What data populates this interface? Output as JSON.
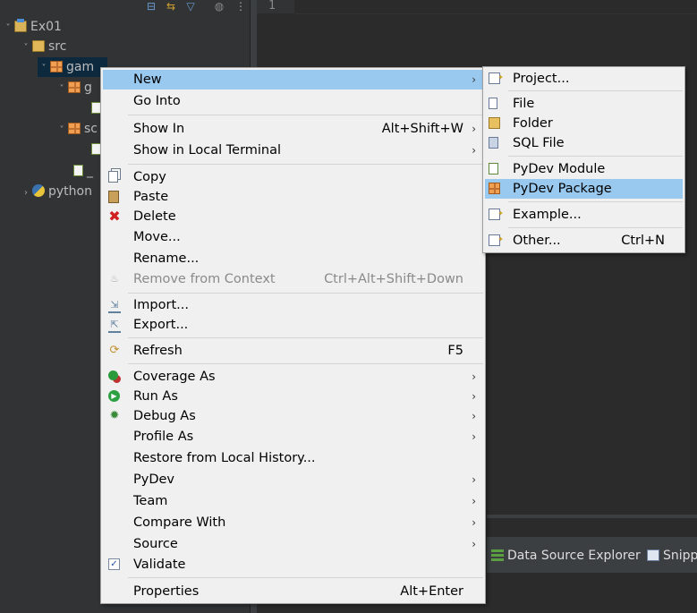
{
  "explorer": {
    "tree": [
      {
        "label": "Ex01",
        "icon": "project-icon",
        "arrow": "˅"
      },
      {
        "label": "src",
        "icon": "source-folder-icon",
        "arrow": "˅"
      },
      {
        "label": "gam",
        "icon": "package-icon",
        "arrow": "˅"
      },
      {
        "label": "g",
        "icon": "package-icon",
        "arrow": "˅"
      },
      {
        "label": "sc",
        "icon": "package-icon",
        "arrow": "˅"
      },
      {
        "label": "_",
        "icon": "pyfile-icon",
        "arrow": ""
      },
      {
        "label": "python",
        "icon": "python-icon",
        "arrow": "›"
      }
    ]
  },
  "editor": {
    "line_number": "1"
  },
  "bottom_tabs": [
    {
      "label": "Data Source Explorer",
      "icon": "data-source-icon"
    },
    {
      "label": "Snipp",
      "icon": "snippets-icon"
    }
  ],
  "context_menu": {
    "items": [
      {
        "label": "New",
        "shortcut": "",
        "submenu": true
      },
      {
        "label": "Go Into",
        "shortcut": "",
        "submenu": false
      },
      {
        "label": "Show In",
        "shortcut": "Alt+Shift+W",
        "submenu": true
      },
      {
        "label": "Show in Local Terminal",
        "shortcut": "",
        "submenu": true
      },
      {
        "label": "Copy",
        "shortcut": "",
        "submenu": false
      },
      {
        "label": "Paste",
        "shortcut": "",
        "submenu": false
      },
      {
        "label": "Delete",
        "shortcut": "",
        "submenu": false
      },
      {
        "label": "Move...",
        "shortcut": "",
        "submenu": false
      },
      {
        "label": "Rename...",
        "shortcut": "",
        "submenu": false
      },
      {
        "label": "Remove from Context",
        "shortcut": "Ctrl+Alt+Shift+Down",
        "submenu": false
      },
      {
        "label": "Import...",
        "shortcut": "",
        "submenu": false
      },
      {
        "label": "Export...",
        "shortcut": "",
        "submenu": false
      },
      {
        "label": "Refresh",
        "shortcut": "F5",
        "submenu": false
      },
      {
        "label": "Coverage As",
        "shortcut": "",
        "submenu": true
      },
      {
        "label": "Run As",
        "shortcut": "",
        "submenu": true
      },
      {
        "label": "Debug As",
        "shortcut": "",
        "submenu": true
      },
      {
        "label": "Profile As",
        "shortcut": "",
        "submenu": true
      },
      {
        "label": "Restore from Local History...",
        "shortcut": "",
        "submenu": false
      },
      {
        "label": "PyDev",
        "shortcut": "",
        "submenu": true
      },
      {
        "label": "Team",
        "shortcut": "",
        "submenu": true
      },
      {
        "label": "Compare With",
        "shortcut": "",
        "submenu": true
      },
      {
        "label": "Source",
        "shortcut": "",
        "submenu": true
      },
      {
        "label": "Validate",
        "shortcut": "",
        "submenu": false
      },
      {
        "label": "Properties",
        "shortcut": "Alt+Enter",
        "submenu": false
      }
    ]
  },
  "submenu": {
    "items": [
      {
        "label": "Project...",
        "shortcut": ""
      },
      {
        "label": "File",
        "shortcut": ""
      },
      {
        "label": "Folder",
        "shortcut": ""
      },
      {
        "label": "SQL File",
        "shortcut": ""
      },
      {
        "label": "PyDev Module",
        "shortcut": ""
      },
      {
        "label": "PyDev Package",
        "shortcut": ""
      },
      {
        "label": "Example...",
        "shortcut": ""
      },
      {
        "label": "Other...",
        "shortcut": "Ctrl+N"
      }
    ]
  },
  "colors": {
    "highlight": "#99c9ef",
    "menu_bg": "#f0f0f0",
    "ide_bg": "#2b2b2b"
  }
}
